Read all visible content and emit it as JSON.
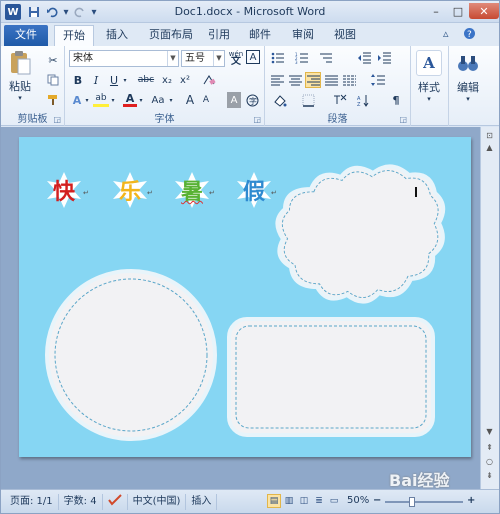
{
  "window": {
    "title": "Doc1.docx - Microsoft Word",
    "app_icon": "W",
    "controls": {
      "minimize": "–",
      "maximize": "□",
      "close": "✕"
    }
  },
  "quick_access": {
    "save_icon": "save-icon",
    "undo_icon": "undo-icon",
    "redo_icon": "redo-icon",
    "customize_icon": "▾"
  },
  "tabs": [
    {
      "label": "文件"
    },
    {
      "label": "开始"
    },
    {
      "label": "插入"
    },
    {
      "label": "页面布局"
    },
    {
      "label": "引用"
    },
    {
      "label": "邮件"
    },
    {
      "label": "审阅"
    },
    {
      "label": "视图"
    }
  ],
  "clipboard": {
    "paste_label": "粘贴",
    "group_label": "剪贴板"
  },
  "font": {
    "font_name": "宋体",
    "font_size": "五号",
    "group_label": "字体",
    "wen_label": "wén",
    "buttons": {
      "bold": "B",
      "italic": "I",
      "underline": "U",
      "strike": "abc",
      "subscript": "x₂",
      "superscript": "x²",
      "grow": "A",
      "shrink": "A",
      "case": "Aa",
      "char_border": "A",
      "highlight": "ab",
      "color": "A",
      "shade": "A"
    }
  },
  "paragraph": {
    "group_label": "段落"
  },
  "styles": {
    "label": "样式"
  },
  "editing": {
    "label": "编辑"
  },
  "document": {
    "chars": [
      {
        "text": "快",
        "color": "#d21f1f"
      },
      {
        "text": "乐",
        "color": "#f2b51a"
      },
      {
        "text": "暑",
        "color": "#58b234"
      },
      {
        "text": "假",
        "color": "#2f8ad0"
      }
    ],
    "paragraph_mark": "↵",
    "page_bg": "#86d6f3"
  },
  "status": {
    "page": "页面: 1/1",
    "words": "字数: 4",
    "language": "中文(中国)",
    "insert": "插入",
    "zoom": "50%",
    "zoom_minus": "−",
    "zoom_plus": "+"
  },
  "watermark": "Bai经验"
}
